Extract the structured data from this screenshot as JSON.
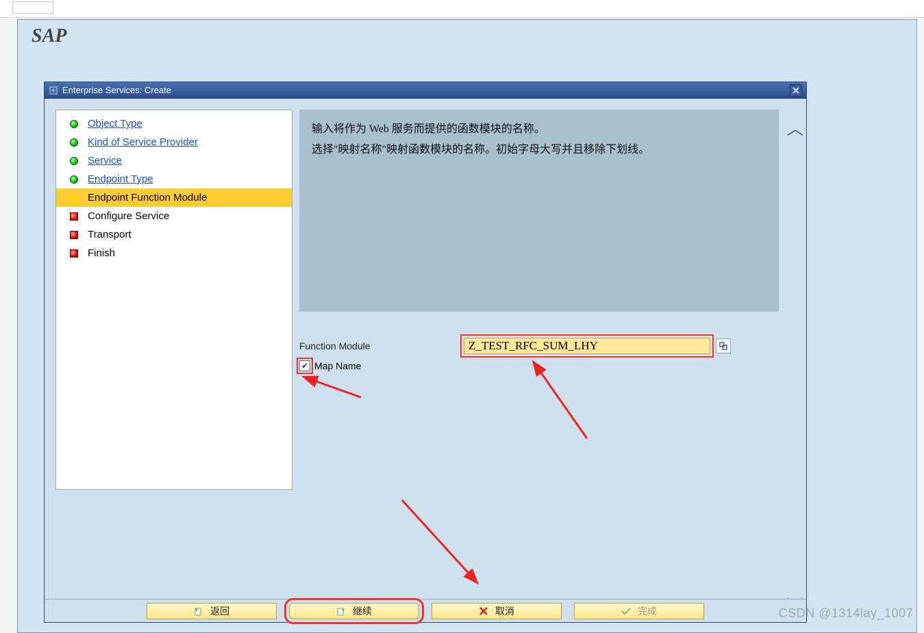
{
  "app": {
    "logo": "SAP"
  },
  "dialog": {
    "title": "Enterprise Services: Create",
    "close_tooltip": "Close"
  },
  "nav": {
    "items": [
      {
        "label": "Object Type",
        "status": "green",
        "link": true,
        "current": false
      },
      {
        "label": "Kind of Service Provider",
        "status": "green",
        "link": true,
        "current": false
      },
      {
        "label": "Service",
        "status": "green",
        "link": true,
        "current": false
      },
      {
        "label": "Endpoint Type",
        "status": "green",
        "link": true,
        "current": false
      },
      {
        "label": "Endpoint Function Module",
        "status": "yellow",
        "link": false,
        "current": true
      },
      {
        "label": "Configure Service",
        "status": "red",
        "link": false,
        "current": false
      },
      {
        "label": "Transport",
        "status": "red",
        "link": false,
        "current": false
      },
      {
        "label": "Finish",
        "status": "red",
        "link": false,
        "current": false
      }
    ]
  },
  "description": {
    "line1": "输入将作为 Web 服务而提供的函数模块的名称。",
    "line2": "选择\"映射名称\"映射函数模块的名称。初始字母大写并且移除下划线。"
  },
  "form": {
    "function_module_label": "Function Module",
    "function_module_value": "Z_TEST_RFC_SUM_LHY",
    "map_name_label": "Map Name",
    "map_name_checked": true,
    "search_help_tooltip": "Value Help"
  },
  "buttons": {
    "back": "返回",
    "continue": "继续",
    "cancel": "取消",
    "finish": "完成"
  },
  "watermark": "CSDN @1314lay_1007"
}
